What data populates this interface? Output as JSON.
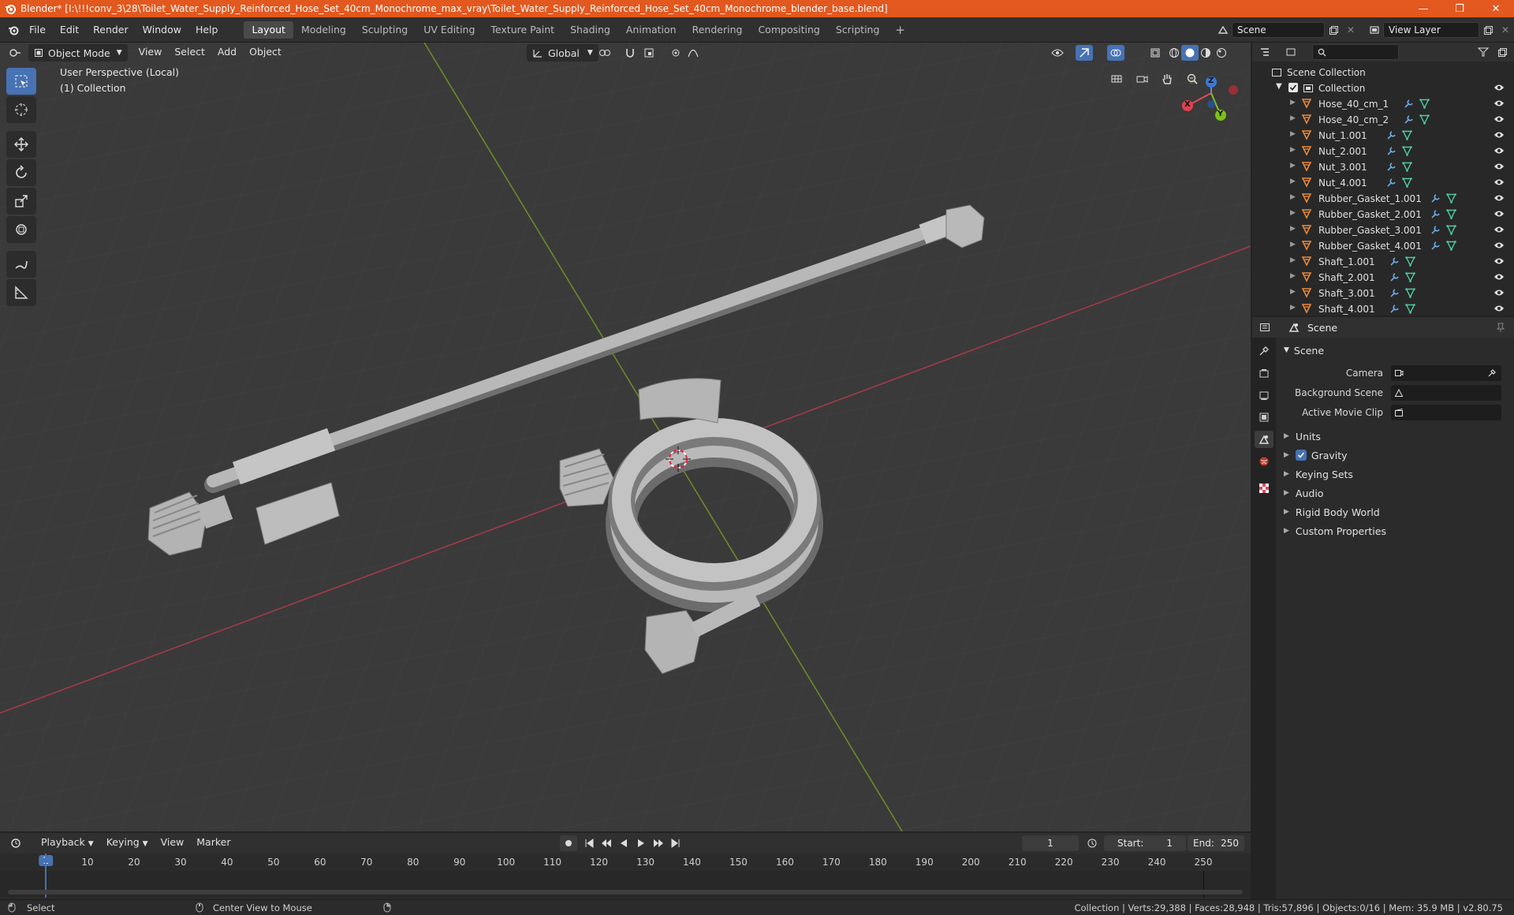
{
  "window": {
    "title": "Blender* [I:\\!!!conv_3\\28\\Toilet_Water_Supply_Reinforced_Hose_Set_40cm_Monochrome_max_vray\\Toilet_Water_Supply_Reinforced_Hose_Set_40cm_Monochrome_blender_base.blend]",
    "minimize": "—",
    "maximize": "❐",
    "close": "✕"
  },
  "menu": [
    "File",
    "Edit",
    "Render",
    "Window",
    "Help"
  ],
  "workspaces": [
    "Layout",
    "Modeling",
    "Sculpting",
    "UV Editing",
    "Texture Paint",
    "Shading",
    "Animation",
    "Rendering",
    "Compositing",
    "Scripting"
  ],
  "workspace_add": "+",
  "scene_field": "Scene",
  "view_layer_field": "View Layer",
  "viewport": {
    "mode": "Object Mode",
    "menus": [
      "View",
      "Select",
      "Add",
      "Object"
    ],
    "transform_orientation": "Global",
    "overlay_line1": "User Perspective (Local)",
    "overlay_line2": "(1) Collection",
    "gizmo_x": "X",
    "gizmo_y": "Y",
    "gizmo_z": "Z"
  },
  "outliner": {
    "root": "Scene Collection",
    "collection": "Collection",
    "items": [
      "Hose_40_cm_1",
      "Hose_40_cm_2",
      "Nut_1.001",
      "Nut_2.001",
      "Nut_3.001",
      "Nut_4.001",
      "Rubber_Gasket_1.001",
      "Rubber_Gasket_2.001",
      "Rubber_Gasket_3.001",
      "Rubber_Gasket_4.001",
      "Shaft_1.001",
      "Shaft_2.001",
      "Shaft_3.001",
      "Shaft_4.001"
    ]
  },
  "properties": {
    "header": "Scene",
    "section": "Scene",
    "rows": [
      {
        "label": "Camera"
      },
      {
        "label": "Background Scene"
      },
      {
        "label": "Active Movie Clip"
      }
    ],
    "subsections": [
      "Units",
      "Gravity",
      "Keying Sets",
      "Audio",
      "Rigid Body World",
      "Custom Properties"
    ],
    "accent": "#4772b3"
  },
  "timeline": {
    "menus": [
      "Playback",
      "Keying",
      "View",
      "Marker"
    ],
    "current_frame": "1",
    "start_label": "Start:",
    "start": "1",
    "end_label": "End:",
    "end": "250",
    "ticks": [
      "1",
      "10",
      "20",
      "30",
      "40",
      "50",
      "60",
      "70",
      "80",
      "90",
      "100",
      "110",
      "120",
      "130",
      "140",
      "150",
      "160",
      "170",
      "180",
      "190",
      "200",
      "210",
      "220",
      "230",
      "240",
      "250"
    ]
  },
  "status": {
    "left": "Select",
    "middle": "Center View to Mouse",
    "right": "Collection | Verts:29,388 | Faces:28,948 | Tris:57,896 | Objects:0/16 | Mem: 35.9 MB | v2.80.75"
  }
}
